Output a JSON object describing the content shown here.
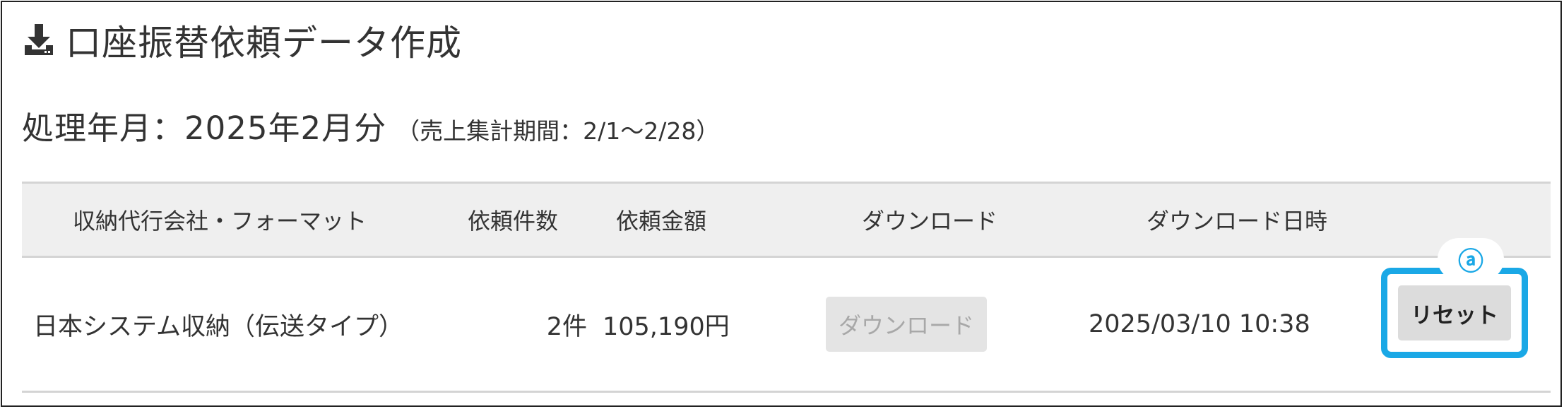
{
  "header": {
    "icon": "download-icon",
    "title": "口座振替依頼データ作成"
  },
  "period": {
    "main": "処理年月：2025年2月分",
    "sub": "（売上集計期間：2/1～2/28）"
  },
  "table": {
    "headers": [
      "収納代行会社・フォーマット",
      "依頼件数",
      "依頼金額",
      "ダウンロード",
      "ダウンロード日時"
    ],
    "rows": [
      {
        "company_format": "日本システム収納（伝送タイプ）",
        "count": "2件",
        "amount": "105,190円",
        "download_label": "ダウンロード",
        "download_datetime": "2025/03/10 10:38",
        "reset_label": "リセット"
      }
    ]
  },
  "annotation": {
    "marker": "ⓐ",
    "accent_color": "#1aa8e6"
  },
  "colors": {
    "header_bg": "#efefef",
    "disabled_button_bg": "#e4e4e4",
    "reset_button_bg": "#dcdcdc"
  }
}
